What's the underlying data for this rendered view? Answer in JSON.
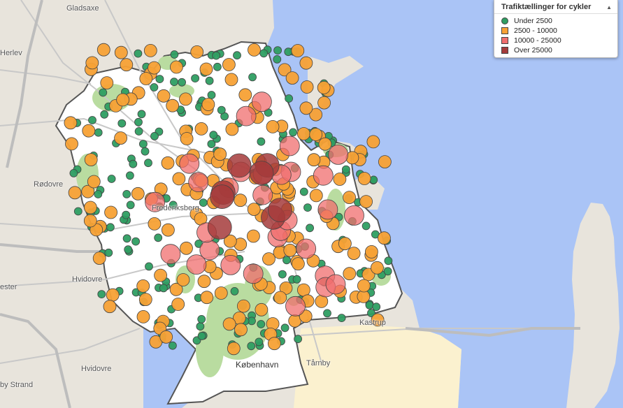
{
  "map": {
    "place_labels": [
      {
        "id": "gladsaxe",
        "text": "Gladsaxe"
      },
      {
        "id": "herlev",
        "text": "Herlev"
      },
      {
        "id": "rodovre",
        "text": "Rødovre"
      },
      {
        "id": "frederiksberg",
        "text": "Frederiksberg"
      },
      {
        "id": "hvidovre-1",
        "text": "Hvidovre"
      },
      {
        "id": "hvidovre-2",
        "text": "Hvidovre"
      },
      {
        "id": "kastrup",
        "text": "Kastrup"
      },
      {
        "id": "kobenhavn",
        "text": "København"
      },
      {
        "id": "tarnby",
        "text": "Tårnby"
      },
      {
        "id": "by-strand",
        "text": "by Strand"
      },
      {
        "id": "ester",
        "text": "ester"
      }
    ],
    "colors": {
      "sea": "#aac4f6",
      "land": "#e8e4dc",
      "city": "#ffffff",
      "park": "#b9dca0",
      "boundary": "#555555",
      "road": "#c8c8c8",
      "motorway": "#bdbdbd",
      "yellow_area": "#fbf1cf"
    },
    "marker_palette": {
      "cat1": "#2e9e62",
      "cat2": "#f7a135",
      "cat3": "#f06e6e",
      "cat4": "#a53b3b"
    }
  },
  "legend": {
    "title": "Trafiktællinger for cykler",
    "toggle_icon": "collapse-up-icon",
    "items": [
      {
        "label": "Under 2500",
        "color": "#2e9e62",
        "shape": "circle"
      },
      {
        "label": "2500 - 10000",
        "color": "#f7a135",
        "shape": "square"
      },
      {
        "label": "10000 - 25000",
        "color": "#f06e6e",
        "shape": "square"
      },
      {
        "label": "Over 25000",
        "color": "#a53b3b",
        "shape": "square"
      }
    ]
  }
}
